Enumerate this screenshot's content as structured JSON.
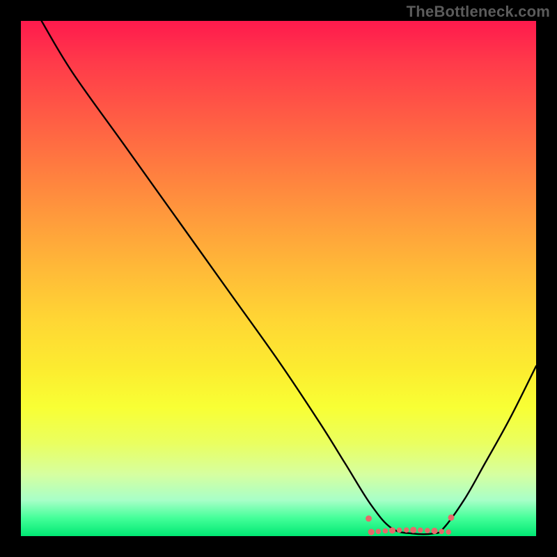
{
  "watermark": "TheBottleneck.com",
  "chart_data": {
    "type": "line",
    "title": "",
    "xlabel": "",
    "ylabel": "",
    "xlim": [
      0,
      100
    ],
    "ylim": [
      0,
      100
    ],
    "description": "Bottleneck curve over vertical red-to-green gradient; minimum (0%) region around x≈70–82. Curve rises steeply at low x (100% at x≈4) and again toward x=100 (≈33%).",
    "series": [
      {
        "name": "bottleneck-curve",
        "x": [
          4,
          10,
          20,
          30,
          40,
          50,
          58,
          63,
          68,
          72,
          76,
          80,
          82,
          86,
          90,
          95,
          100
        ],
        "values": [
          100,
          90,
          76,
          62,
          48,
          34,
          22,
          14,
          6,
          1.5,
          0.5,
          0.5,
          1.5,
          7,
          14,
          23,
          33
        ]
      }
    ],
    "optimal_region": {
      "x_start": 68,
      "x_end": 83,
      "y_approx": 1.2,
      "marker_color": "#e66a6a"
    },
    "gradient_stops": [
      {
        "pct": 0,
        "color": "#ff1a4d"
      },
      {
        "pct": 50,
        "color": "#ffb938"
      },
      {
        "pct": 75,
        "color": "#f8ff34"
      },
      {
        "pct": 100,
        "color": "#00e873"
      }
    ]
  }
}
